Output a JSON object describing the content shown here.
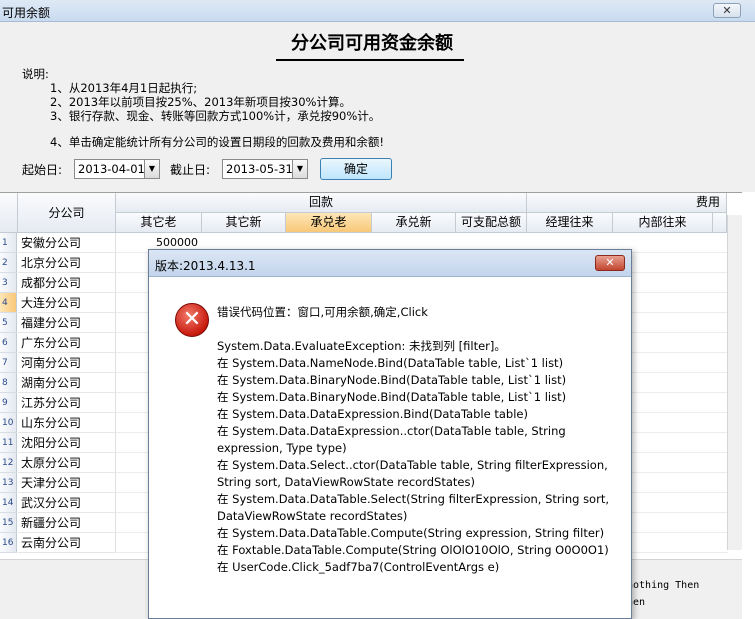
{
  "window": {
    "title": "可用余额",
    "close": "✕"
  },
  "report": {
    "title": "分公司可用资金余额"
  },
  "notes": {
    "heading": "说明:",
    "items": [
      "1、从2013年4月1日起执行;",
      "2、2013年以前项目按25%、2013年新项目按30%计算。",
      "3、银行存款、现金、转账等回款方式100%计，承兑按90%计。",
      "4、单击确定能统计所有分公司的设置日期段的回款及费用和余额!"
    ]
  },
  "filter": {
    "start_label": "起始日:",
    "start_value": "2013-04-01",
    "end_label": "截止日:",
    "end_value": "2013-05-31",
    "ok_label": "确定"
  },
  "grid": {
    "col_company": "分公司",
    "group_huikuan": "回款",
    "group_feiyong": "费用",
    "sub_headers": [
      "其它老",
      "其它新",
      "承兑老",
      "承兑新",
      "可支配总额",
      "经理往来",
      "内部往来"
    ],
    "rows": [
      {
        "num": "1",
        "name": "安徽分公司",
        "qitalao": "500000"
      },
      {
        "num": "2",
        "name": "北京分公司",
        "qitalao": ""
      },
      {
        "num": "3",
        "name": "成都分公司",
        "qitalao": ""
      },
      {
        "num": "4",
        "name": "大连分公司",
        "qitalao": ""
      },
      {
        "num": "5",
        "name": "福建分公司",
        "qitalao": ""
      },
      {
        "num": "6",
        "name": "广东分公司",
        "qitalao": ""
      },
      {
        "num": "7",
        "name": "河南分公司",
        "qitalao": ""
      },
      {
        "num": "8",
        "name": "湖南分公司",
        "qitalao": ""
      },
      {
        "num": "9",
        "name": "江苏分公司",
        "qitalao": ""
      },
      {
        "num": "10",
        "name": "山东分公司",
        "qitalao": ""
      },
      {
        "num": "11",
        "name": "沈阳分公司",
        "qitalao": ""
      },
      {
        "num": "12",
        "name": "太原分公司",
        "qitalao": ""
      },
      {
        "num": "13",
        "name": "天津分公司",
        "qitalao": ""
      },
      {
        "num": "14",
        "name": "武汉分公司",
        "qitalao": ""
      },
      {
        "num": "15",
        "name": "新疆分公司",
        "qitalao": ""
      },
      {
        "num": "16",
        "name": "云南分公司",
        "qitalao": ""
      }
    ]
  },
  "background_code": {
    "line1": "nothing Then",
    "line2": "hen"
  },
  "dialog": {
    "title": "版本:2013.4.13.1",
    "close": "✕",
    "icon": "error-icon",
    "location": "错误代码位置：窗口,可用余额,确定,Click",
    "lines": [
      "System.Data.EvaluateException: 未找到列 [filter]。",
      "   在 System.Data.NameNode.Bind(DataTable table, List`1 list)",
      "   在 System.Data.BinaryNode.Bind(DataTable table, List`1 list)",
      "   在 System.Data.BinaryNode.Bind(DataTable table, List`1 list)",
      "   在 System.Data.DataExpression.Bind(DataTable table)",
      "   在 System.Data.DataExpression..ctor(DataTable table, String expression, Type type)",
      "   在 System.Data.Select..ctor(DataTable table, String filterExpression, String sort, DataViewRowState recordStates)",
      "   在 System.Data.DataTable.Select(String filterExpression, String sort, DataViewRowState recordStates)",
      "   在 System.Data.DataTable.Compute(String expression, String filter)",
      "   在 Foxtable.DataTable.Compute(String OlOlO10OlO, String O0O0O1)",
      "   在 UserCode.Click_5adf7ba7(ControlEventArgs e)"
    ]
  }
}
